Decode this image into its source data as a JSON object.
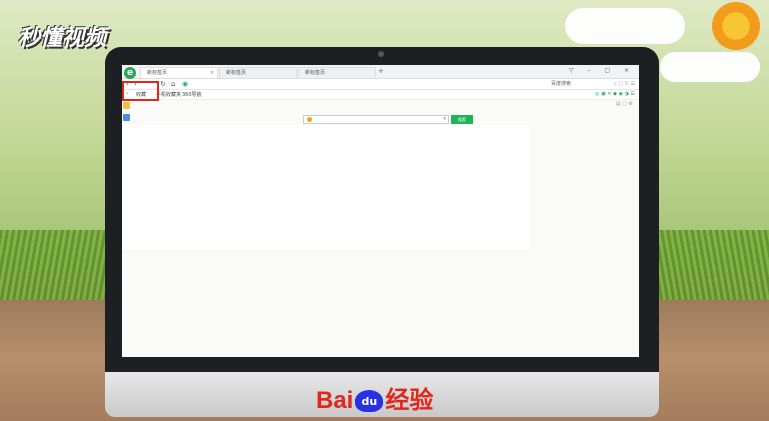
{
  "watermark": {
    "logo_text": "秒懂视频"
  },
  "browser": {
    "logo_glyph": "e",
    "tabs": [
      {
        "label": "新标签页",
        "close": "×"
      },
      {
        "label": "新标签页",
        "close": "×"
      },
      {
        "label": "新标签页",
        "close": "×"
      }
    ],
    "new_tab": "+",
    "window_controls": "▽ – ▢ ×",
    "nav": {
      "back": "‹",
      "forward": "›",
      "refresh": "↻",
      "home": "⌂",
      "shield": "◉",
      "right_search": "百度搜索"
    },
    "bookmarks": {
      "back_arrow": "‹",
      "item1": "收藏",
      "item2": "手机收藏夹",
      "item3": "360导航"
    },
    "search": {
      "dropdown": "▾",
      "button_label": "搜索"
    }
  },
  "footer": {
    "brand_left": "Bai",
    "brand_paw": "du",
    "brand_right": "经验"
  },
  "colors": {
    "highlight": "#e1261c",
    "search_button": "#21b35a",
    "browser_green": "#2aa65a"
  }
}
